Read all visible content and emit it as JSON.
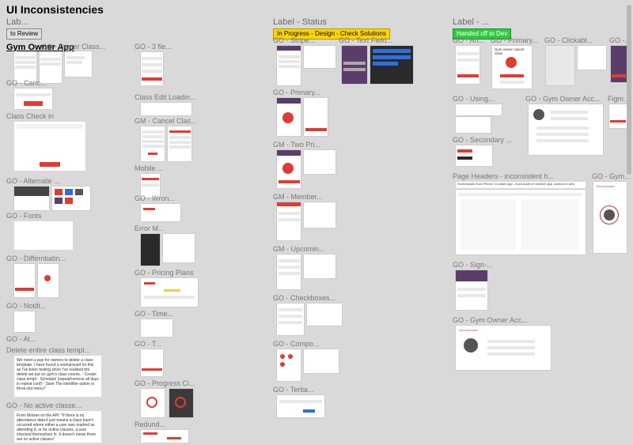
{
  "page_title": "UI Inconsistencies",
  "sections": {
    "lab": "Lab...",
    "status": "Label - Status",
    "right": "Label - ..."
  },
  "tags": {
    "to_review": "to Review",
    "in_progress": "In Progress - Design - Check Solutions",
    "handed_off": "Handed off to Dev"
  },
  "gym_owner_app": "Gym Owner App",
  "col1": [
    {
      "t": "GO - Owner Class..."
    },
    {
      "t": "GO - Canc..."
    },
    {
      "t": "Class Check in"
    },
    {
      "t": "GO - Alternate ..."
    },
    {
      "t": "GO - Fonts"
    },
    {
      "t": "GO - Differntiatin..."
    },
    {
      "t": "GO - Notifi..."
    },
    {
      "t": "GO - At..."
    },
    {
      "t": "Delete entire class templ..."
    },
    {
      "t": "GO - No active classe..."
    }
  ],
  "col2": [
    {
      "t": "GO - 3 fie..."
    },
    {
      "t": "Class Edit Loadin..."
    },
    {
      "t": "GM - Cancel Clas..."
    },
    {
      "t": "Mobile ..."
    },
    {
      "t": "GO - Wron..."
    },
    {
      "t": "Error M..."
    },
    {
      "t": "GO - Pricing Plans"
    },
    {
      "t": "GO - Time..."
    },
    {
      "t": "GO - T..."
    },
    {
      "t": "GO - Progress Ci..."
    },
    {
      "t": "Redund..."
    }
  ],
  "col3": [
    {
      "t": "GO - Stripe..."
    },
    {
      "t": "GO - Text Field..."
    },
    {
      "t": "GO - Primary..."
    },
    {
      "t": "GM - Two Pri..."
    },
    {
      "t": "GM - Member..."
    },
    {
      "t": "GM - Upcomin..."
    },
    {
      "t": "GO - Checkboxes..."
    },
    {
      "t": "GO - Compo..."
    },
    {
      "t": "GO - Tertia..."
    }
  ],
  "col4": [
    {
      "t": "GO - An..."
    },
    {
      "t": "GO - Primary..."
    },
    {
      "t": "GO - Clickabl..."
    },
    {
      "t": "GO - I..."
    },
    {
      "t": "GO - Using..."
    },
    {
      "t": "GO - Gym Owner Acc..."
    },
    {
      "t": "Figma..."
    },
    {
      "t": "GO - Secondary ..."
    },
    {
      "t": "Page Headers - inconsistent h..."
    },
    {
      "t": "GO - Gym ownerP..."
    },
    {
      "t": "GO - Sign-..."
    },
    {
      "t": "GO - Gym Owner Acc..."
    }
  ],
  "notes": {
    "delete_class": "We need a way for owners to delete a class template.\nI have found a workaround for this as I've been testing since I've realised the delete we put on gym's class counts.\n- Create class templ\n- Schedule (repeat/remove all days in repeat conf)\n- Save\nThe identifier option is three-dot menu?",
    "no_active": "From Moises on the API:\n\"If there is no attendance data it just means a class hasn't occurred where either a user was marked as attending it; or for online classes, a user checked themselves in. It doesn't mean there are no active classes\"",
    "page_headers": "Screenshots from iPhone 11 native app - need audit of member app, android & web"
  }
}
